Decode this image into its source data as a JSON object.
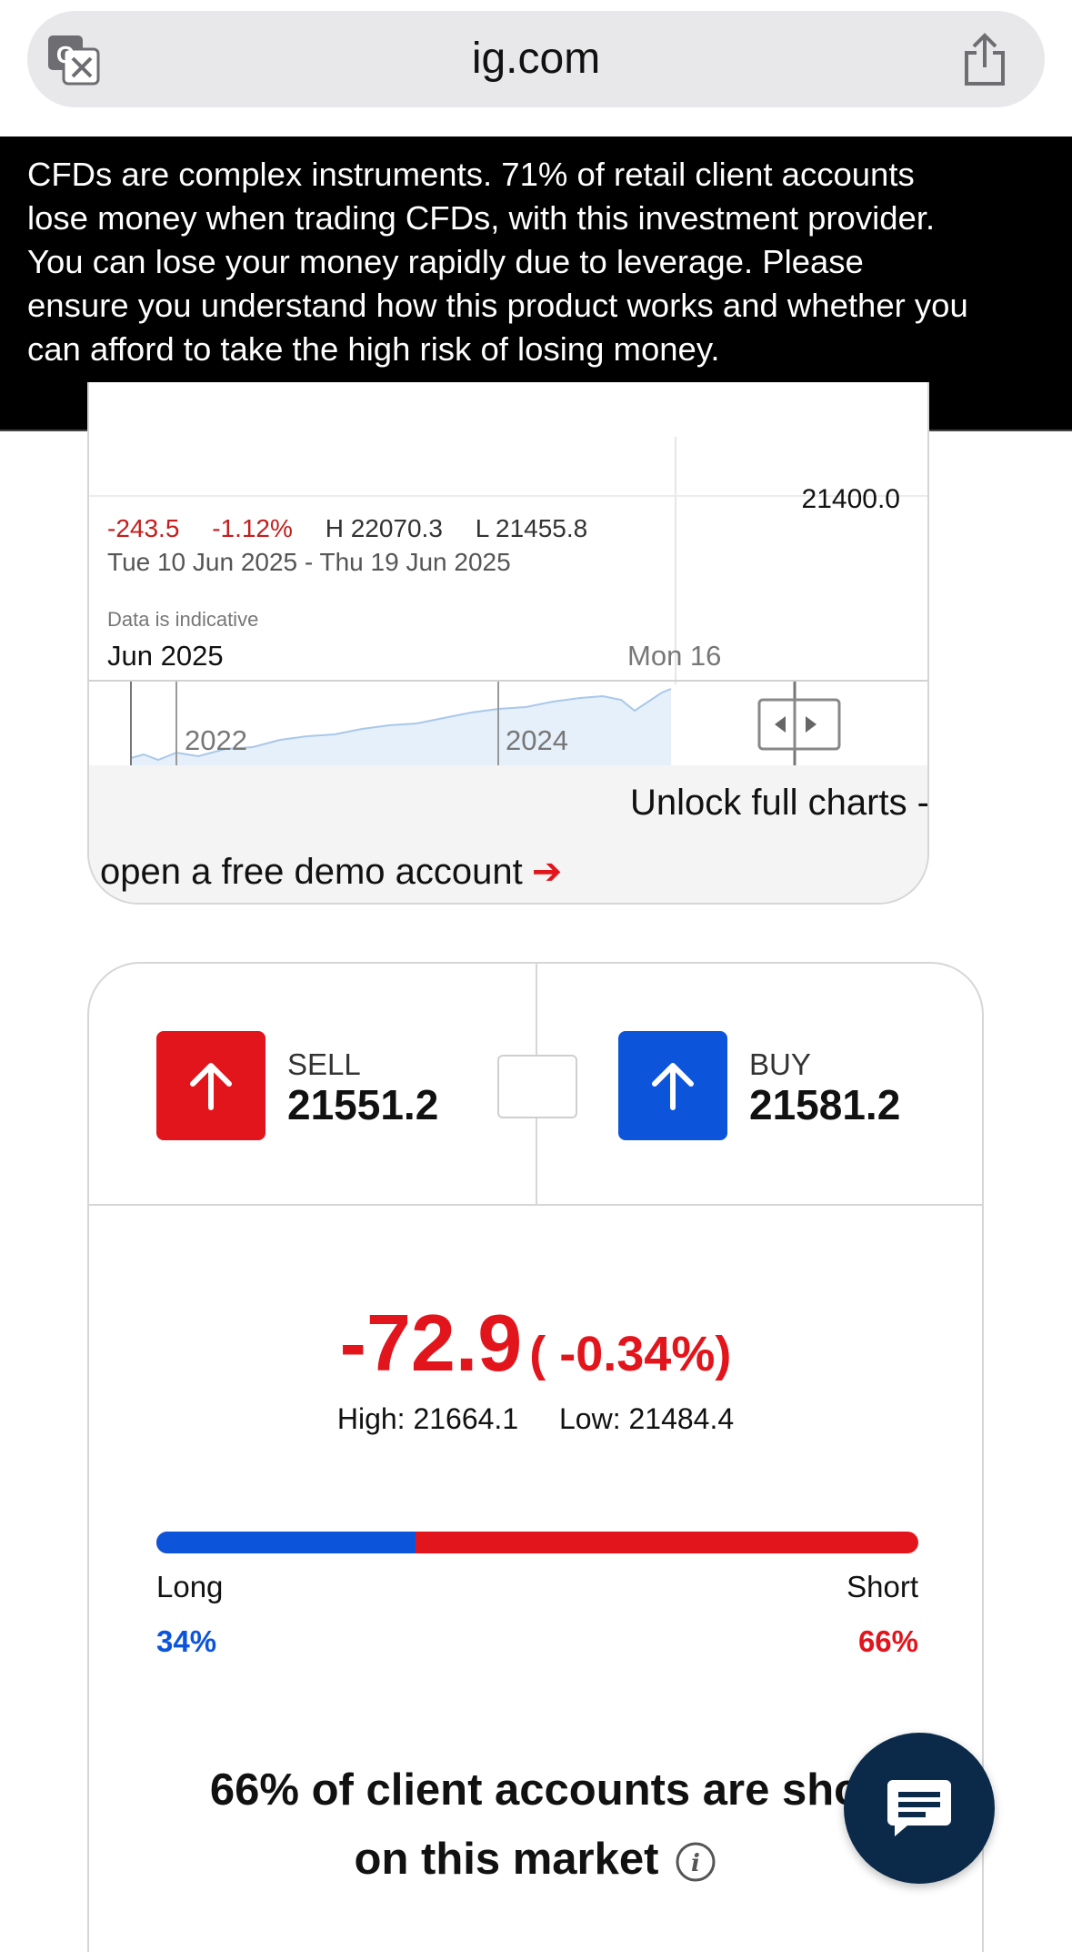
{
  "browser": {
    "url": "ig.com",
    "icons": {
      "translate": "translate-icon",
      "share": "share-icon"
    }
  },
  "risk_warning": "CFDs are complex instruments. 71% of retail client accounts lose money when trading CFDs, with this investment provider. You can lose your money rapidly due to leverage. Please ensure you understand how this product works and whether you can afford to take the high risk of losing money.",
  "chart": {
    "price_level": "21400.0",
    "change": "-243.5",
    "change_pct": "-1.12%",
    "high": "H 22070.3",
    "low": "L 21455.8",
    "date_range": "Tue 10 Jun 2025 - Thu 19 Jun 2025",
    "indicative_note": "Data is indicative",
    "axis_month": "Jun 2025",
    "axis_day": "Mon 16",
    "navigator_years": [
      "2022",
      "2024"
    ],
    "unlock_line1": "Unlock full charts -",
    "unlock_line2": "open a free demo account",
    "unlock_arrow": "➔"
  },
  "trade": {
    "sell_label": "SELL",
    "sell_price": "21551.2",
    "buy_label": "BUY",
    "buy_price": "21581.2",
    "change_value": "-72.9",
    "change_pct": "( -0.34%)",
    "high": "High: 21664.1",
    "low": "Low: 21484.4"
  },
  "sentiment": {
    "long_label": "Long",
    "short_label": "Short",
    "long_pct": "34%",
    "short_pct": "66%",
    "long_fraction": 0.34,
    "statement_line1": "66% of client accounts are sho",
    "statement_line2": "on this market"
  },
  "colors": {
    "sell": "#e3151c",
    "buy": "#0c55db",
    "chat_fab": "#0b2a4a",
    "banner": "#000000"
  }
}
